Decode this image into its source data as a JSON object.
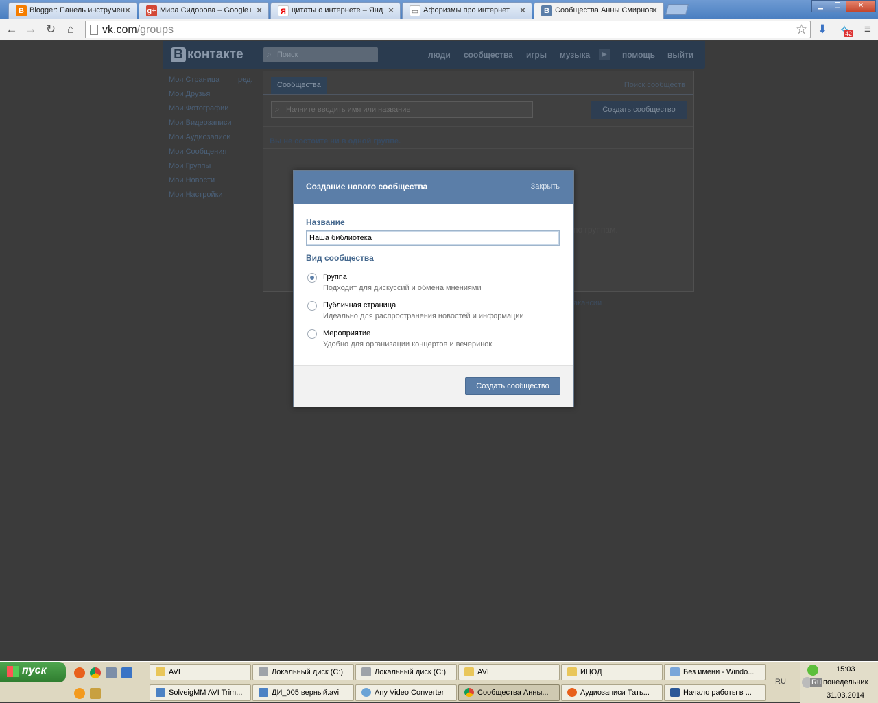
{
  "browser": {
    "tabs": [
      {
        "label": "Blogger: Панель инструмен",
        "icon": "blogger-icon",
        "color": "#f57d00",
        "glyph": "B"
      },
      {
        "label": "Мира Сидорова – Google+",
        "icon": "google-plus-icon",
        "color": "#d34836",
        "glyph": "g+"
      },
      {
        "label": "цитаты о интернете – Янд",
        "icon": "yandex-icon",
        "color": "#ffffff",
        "glyph": "Я"
      },
      {
        "label": "Афоризмы про интернет",
        "icon": "book-icon",
        "color": "#ffffff",
        "glyph": "📖"
      },
      {
        "label": "Сообщества Анны Смирнов",
        "icon": "vk-icon",
        "color": "#5b7ea8",
        "glyph": "B"
      }
    ],
    "close_glyph": "✕",
    "url_host": "vk.com",
    "url_path": "/groups",
    "download_badge": "42"
  },
  "vk": {
    "logo": "контакте",
    "logo_letter": "В",
    "search_placeholder": "Поиск",
    "nav": [
      "люди",
      "сообщества",
      "игры",
      "музыка",
      "помощь",
      "выйти"
    ],
    "sidebar": [
      "Моя Страница",
      "Мои Друзья",
      "Мои Фотографии",
      "Мои Видеозаписи",
      "Мои Аудиозаписи",
      "Мои Сообщения",
      "Мои Группы",
      "Мои Новости",
      "Мои Настройки"
    ],
    "sidebar_edit": "ред.",
    "groups_tab": "Сообщества",
    "groups_search_link": "Поиск сообществ",
    "filter_placeholder": "Начните вводить имя или название",
    "create_button": "Создать сообщество",
    "empty_message": "Вы не состоите ни в одной группе.",
    "partial_text_1": "по группам.",
    "partial_text_2": "акансии"
  },
  "modal": {
    "title": "Создание нового сообщества",
    "close": "Закрыть",
    "name_label": "Название",
    "name_value": "Наша библиотека",
    "type_label": "Вид сообщества",
    "options": [
      {
        "title": "Группа",
        "desc": "Подходит для дискуссий и обмена мнениями",
        "checked": true
      },
      {
        "title": "Публичная страница",
        "desc": "Идеально для распространения новостей и информации",
        "checked": false
      },
      {
        "title": "Мероприятие",
        "desc": "Удобно для организации концертов и вечеринок",
        "checked": false
      }
    ],
    "submit": "Создать сообщество"
  },
  "taskbar": {
    "start": "пуск",
    "row1": [
      {
        "label": "AVI",
        "icon": "folder-icon"
      },
      {
        "label": "Локальный диск (C:)",
        "icon": "drive-icon"
      },
      {
        "label": "Локальный диск (C:)",
        "icon": "drive-icon"
      },
      {
        "label": "AVI",
        "icon": "folder-icon"
      },
      {
        "label": "ИЦОД",
        "icon": "folder-icon"
      },
      {
        "label": "Без имени - Windo...",
        "icon": "paint-icon"
      }
    ],
    "row2": [
      {
        "label": "SolveigMM AVI Trim...",
        "icon": "film-icon"
      },
      {
        "label": "ДИ_005 верный.avi",
        "icon": "film-icon"
      },
      {
        "label": "Any Video Converter",
        "icon": "converter-icon"
      },
      {
        "label": "Сообщества Анны...",
        "icon": "chrome-icon",
        "active": true
      },
      {
        "label": "Аудиозаписи Тать...",
        "icon": "firefox-icon"
      },
      {
        "label": "Начало работы в ...",
        "icon": "word-icon"
      }
    ],
    "lang": "RU",
    "lang2": "Ru",
    "time": "15:03",
    "weekday": "понедельник",
    "date": "31.03.2014"
  }
}
